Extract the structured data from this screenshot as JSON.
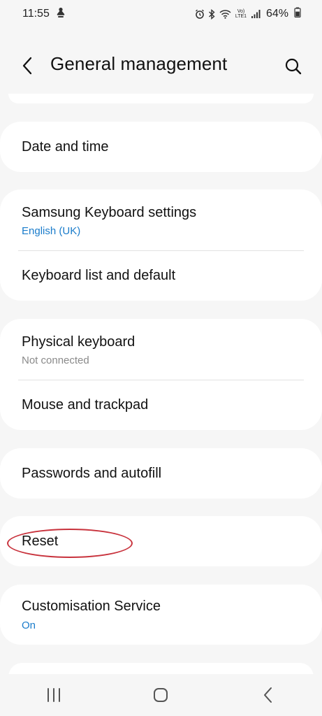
{
  "status_bar": {
    "time": "11:55",
    "battery": "64%",
    "network_label": "Vo) LTE1"
  },
  "header": {
    "title": "General management",
    "back_icon": "chevron-left-icon",
    "search_icon": "search-icon"
  },
  "items": [
    {
      "title": "Date and time"
    },
    {
      "title": "Samsung Keyboard settings",
      "subtitle": "English (UK)"
    },
    {
      "title": "Keyboard list and default"
    },
    {
      "title": "Physical keyboard",
      "subtitle": "Not connected"
    },
    {
      "title": "Mouse and trackpad"
    },
    {
      "title": "Passwords and autofill"
    },
    {
      "title": "Reset"
    },
    {
      "title": "Customisation Service",
      "subtitle": "On"
    }
  ],
  "nav_bar": {
    "recents_icon": "recents-icon",
    "home_icon": "home-icon",
    "back_icon": "back-icon"
  },
  "colors": {
    "accent_blue": "#1a7ccb",
    "highlight_red": "#c8323c",
    "background": "#f6f6f6",
    "card": "#ffffff"
  }
}
